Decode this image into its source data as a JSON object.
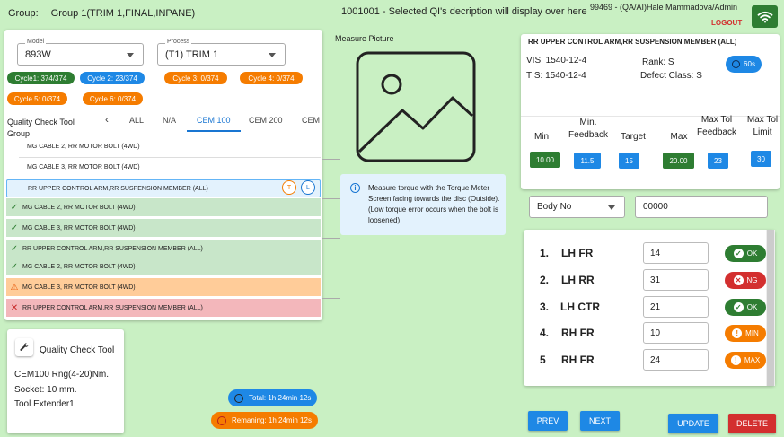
{
  "header": {
    "group_label": "Group:",
    "group_value": "Group 1(TRIM 1,FINAL,INPANE)",
    "qi_text": "1001001 - Selected QI's decription will display over here",
    "user": "99469 - (QA/AI)Hale Mammadova/Admin",
    "logout": "LOGOUT",
    "wifi_icon": "wifi-icon"
  },
  "filters": {
    "model_label": "Model",
    "model_value": "893W",
    "process_label": "Process",
    "process_value": "(T1) TRIM 1"
  },
  "cycles": [
    {
      "label": "Cycle1: 374/374",
      "color": "#2e7d32"
    },
    {
      "label": "Cycle 2: 23/374",
      "color": "#1e88e5"
    },
    {
      "label": "Cycle 3: 0/374",
      "color": "#f57c00"
    },
    {
      "label": "Cycle 4: 0/374",
      "color": "#f57c00"
    },
    {
      "label": "Cycle 5: 0/374",
      "color": "#f57c00"
    },
    {
      "label": "Cycle 6: 0/374",
      "color": "#f57c00"
    }
  ],
  "tabs": {
    "group_label": "Quality Check Tool Group",
    "prev_arrow": "‹",
    "items": [
      "ALL",
      "N/A",
      "CEM 100",
      "CEM 200",
      "CEM 3"
    ],
    "active": "CEM 100"
  },
  "checks": [
    {
      "label": "MG CABLE 2, RR MOTOR BOLT (4WD)",
      "state": "plain"
    },
    {
      "label": "MG CABLE 3, RR MOTOR BOLT (4WD)",
      "state": "plain"
    },
    {
      "label": "RR UPPER CONTROL ARM,RR SUSPENSION  MEMBER (ALL)",
      "state": "selected",
      "tags": [
        "T",
        "L"
      ]
    },
    {
      "label": "MG CABLE 2, RR MOTOR BOLT (4WD)",
      "state": "ok"
    },
    {
      "label": "MG CABLE 3, RR MOTOR BOLT (4WD)",
      "state": "ok"
    },
    {
      "label": "RR UPPER CONTROL ARM,RR SUSPENSION  MEMBER (ALL)",
      "state": "ok"
    },
    {
      "label": "MG CABLE 2, RR MOTOR BOLT (4WD)",
      "state": "ok"
    },
    {
      "label": "MG CABLE 3, RR MOTOR BOLT (4WD)",
      "state": "warn"
    },
    {
      "label": "RR UPPER CONTROL ARM,RR SUSPENSION  MEMBER (ALL)",
      "state": "err"
    }
  ],
  "tool": {
    "title": "Quality Check Tool",
    "icon": "wrench-icon",
    "lines": [
      "CEM100 Rng(4-20)Nm.",
      "Socket: 10 mm.",
      "Tool Extender1"
    ]
  },
  "timers": {
    "total": "Total: 1h 24min 12s",
    "remaining": "Remaning: 1h 24min 12s"
  },
  "measure": {
    "title": "Measure Picture",
    "info": "Measure torque with the Torque Meter Screen facing towards the disc (Outside). (Low torque error occurs when the bolt is loosened)"
  },
  "spec": {
    "title": "RR UPPER CONTROL ARM,RR SUSPENSION  MEMBER (ALL)",
    "vis": "VIS: 1540-12-4",
    "tis": "TIS: 1540-12-4",
    "rank": "Rank: S",
    "defect": "Defect Class: S",
    "timer": "60s",
    "columns": [
      {
        "header": "Min",
        "value": "10.00",
        "color": "green"
      },
      {
        "header": "Min. Feedback",
        "value": "11.5",
        "color": "blue"
      },
      {
        "header": "Target",
        "value": "15",
        "color": "blue"
      },
      {
        "header": "Max",
        "value": "20.00",
        "color": "green"
      },
      {
        "header": "Max Tol Feedback",
        "value": "23",
        "color": "blue"
      },
      {
        "header": "Max Tol Limit",
        "value": "30",
        "color": "blue"
      }
    ]
  },
  "body": {
    "select_value": "Body No",
    "input_value": "00000"
  },
  "measurements": [
    {
      "num": "1.",
      "label": "LH FR",
      "value": "14",
      "status": "OK",
      "kind": "ok"
    },
    {
      "num": "2.",
      "label": "LH RR",
      "value": "31",
      "status": "NG",
      "kind": "ng"
    },
    {
      "num": "3.",
      "label": "LH CTR",
      "value": "21",
      "status": "OK",
      "kind": "ok"
    },
    {
      "num": "4.",
      "label": "RH FR",
      "value": "10",
      "status": "MIN",
      "kind": "warn"
    },
    {
      "num": "5",
      "label": "RH FR",
      "value": "24",
      "status": "MAX",
      "kind": "warn"
    }
  ],
  "buttons": {
    "prev": "PREV",
    "next": "NEXT",
    "update": "UPDATE",
    "delete": "DELETE"
  }
}
